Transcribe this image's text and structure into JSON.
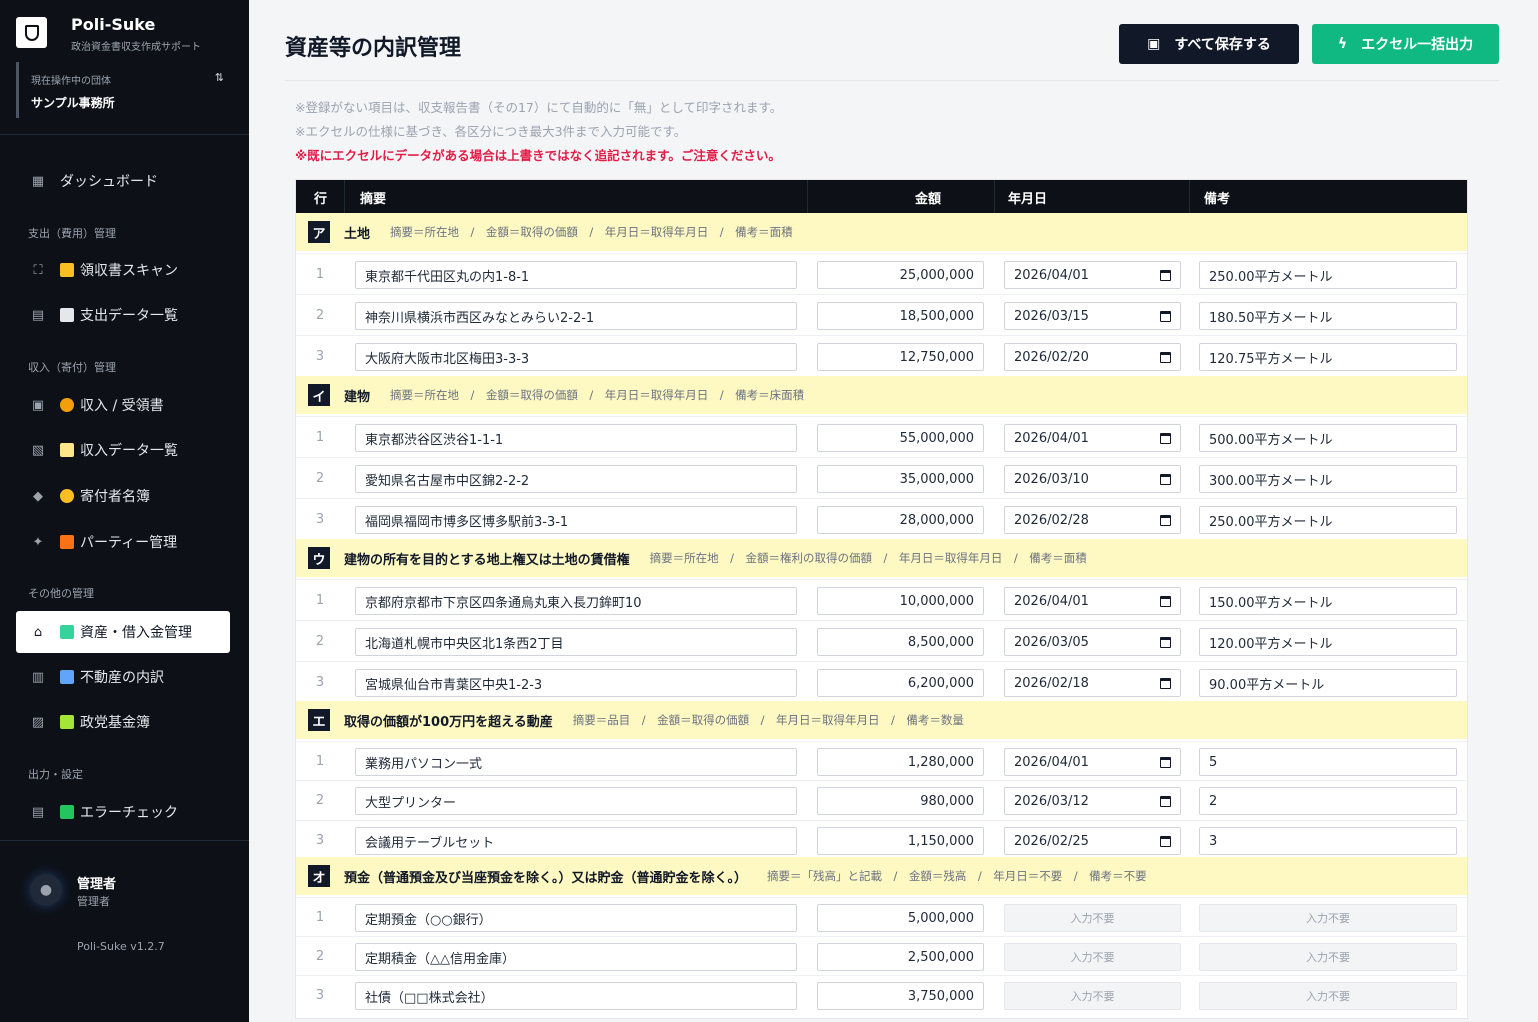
{
  "sidebar": {
    "brand": {
      "name": "Poli-Suke",
      "subtitle": "政治資金書収支作成サポート"
    },
    "org": {
      "label": "現在操作中の団体",
      "name": "サンプル事務所",
      "switch_glyph": "⇅"
    },
    "dashboard": "ダッシュボード",
    "sections": {
      "expense": "支出（費用）管理",
      "income": "収入（寄付）管理",
      "other": "その他の管理",
      "output": "出力・設定"
    },
    "items": {
      "receipt_scan": "領収書スキャン",
      "expense_list": "支出データ一覧",
      "income_receipt": "収入 / 受領書",
      "income_list": "収入データ一覧",
      "donors": "寄付者名簿",
      "party": "パーティー管理",
      "assets": "資産・借入金管理",
      "realestate": "不動産の内訳",
      "fund": "政党基金簿",
      "errorcheck": "エラーチェック"
    },
    "user": {
      "name": "管理者",
      "role": "管理者"
    },
    "version": "Poli-Suke v1.2.7"
  },
  "header": {
    "title": "資産等の内訳管理",
    "save_label": "すべて保存する",
    "export_label": "エクセル一括出力"
  },
  "notes": {
    "line1": "※登録がない項目は、収支報告書（その17）にて自動的に「無」として印字されます。",
    "line2": "※エクセルの仕様に基づき、各区分につき最大3件まで入力可能です。",
    "warning": "※既にエクセルにデータがある場合は上書きではなく追記されます。ご注意ください。"
  },
  "table": {
    "columns": {
      "row": "行",
      "desc": "摘要",
      "amount": "金額",
      "date": "年月日",
      "note": "備考"
    },
    "disabled_label": "入力不要",
    "categories": [
      {
        "badge": "ア",
        "name": "土地",
        "hint": "摘要＝所在地　/　金額＝取得の価額　/　年月日＝取得年月日　/　備考＝面積",
        "rows": [
          {
            "no": "1",
            "desc": "東京都千代田区丸の内1-8-1",
            "amount": "25,000,000",
            "date": "2026/04/01",
            "note": "250.00平方メートル"
          },
          {
            "no": "2",
            "desc": "神奈川県横浜市西区みなとみらい2-2-1",
            "amount": "18,500,000",
            "date": "2026/03/15",
            "note": "180.50平方メートル"
          },
          {
            "no": "3",
            "desc": "大阪府大阪市北区梅田3-3-3",
            "amount": "12,750,000",
            "date": "2026/02/20",
            "note": "120.75平方メートル"
          }
        ]
      },
      {
        "badge": "イ",
        "name": "建物",
        "hint": "摘要＝所在地　/　金額＝取得の価額　/　年月日＝取得年月日　/　備考＝床面積",
        "rows": [
          {
            "no": "1",
            "desc": "東京都渋谷区渋谷1-1-1",
            "amount": "55,000,000",
            "date": "2026/04/01",
            "note": "500.00平方メートル"
          },
          {
            "no": "2",
            "desc": "愛知県名古屋市中区錦2-2-2",
            "amount": "35,000,000",
            "date": "2026/03/10",
            "note": "300.00平方メートル"
          },
          {
            "no": "3",
            "desc": "福岡県福岡市博多区博多駅前3-3-1",
            "amount": "28,000,000",
            "date": "2026/02/28",
            "note": "250.00平方メートル"
          }
        ]
      },
      {
        "badge": "ウ",
        "name": "建物の所有を目的とする地上権又は土地の賃借権",
        "hint": "摘要＝所在地　/　金額＝権利の取得の価額　/　年月日＝取得年月日　/　備考＝面積",
        "rows": [
          {
            "no": "1",
            "desc": "京都府京都市下京区四条通烏丸東入長刀鉾町10",
            "amount": "10,000,000",
            "date": "2026/04/01",
            "note": "150.00平方メートル"
          },
          {
            "no": "2",
            "desc": "北海道札幌市中央区北1条西2丁目",
            "amount": "8,500,000",
            "date": "2026/03/05",
            "note": "120.00平方メートル"
          },
          {
            "no": "3",
            "desc": "宮城県仙台市青葉区中央1-2-3",
            "amount": "6,200,000",
            "date": "2026/02/18",
            "note": "90.00平方メートル"
          }
        ]
      },
      {
        "badge": "エ",
        "name": "取得の価額が100万円を超える動産",
        "hint": "摘要＝品目　/　金額＝取得の価額　/　年月日＝取得年月日　/　備考＝数量",
        "rows": [
          {
            "no": "1",
            "desc": "業務用パソコン一式",
            "amount": "1,280,000",
            "date": "2026/04/01",
            "note": "5"
          },
          {
            "no": "2",
            "desc": "大型プリンター",
            "amount": "980,000",
            "date": "2026/03/12",
            "note": "2"
          },
          {
            "no": "3",
            "desc": "会議用テーブルセット",
            "amount": "1,150,000",
            "date": "2026/02/25",
            "note": "3"
          }
        ]
      },
      {
        "badge": "オ",
        "name": "預金（普通預金及び当座預金を除く。）又は貯金（普通貯金を除く。）",
        "hint": "摘要＝「残高」と記載　/　金額＝残高　/　年月日＝不要　/　備考＝不要",
        "rows": [
          {
            "no": "1",
            "desc": "定期預金（○○銀行）",
            "amount": "5,000,000"
          },
          {
            "no": "2",
            "desc": "定期積金（△△信用金庫）",
            "amount": "2,500,000"
          },
          {
            "no": "3",
            "desc": "社債（□□株式会社）",
            "amount": "3,750,000"
          }
        ]
      }
    ]
  }
}
